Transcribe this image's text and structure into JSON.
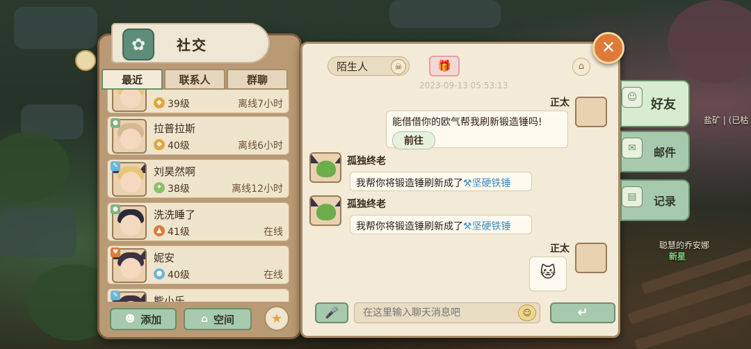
{
  "panel": {
    "title": "社交",
    "tabs": [
      "最近",
      "联系人",
      "群聊"
    ],
    "friends": [
      {
        "name": "",
        "level": "39级",
        "status": "离线7小时",
        "lvl_color": "orange"
      },
      {
        "name": "拉普拉斯",
        "level": "40级",
        "status": "离线6小时",
        "lvl_color": "orange"
      },
      {
        "name": "刘昊然啊",
        "level": "38级",
        "status": "离线12小时",
        "lvl_color": "green"
      },
      {
        "name": "洗洗睡了",
        "level": "41级",
        "status": "在线",
        "lvl_color": "orange"
      },
      {
        "name": "妮安",
        "level": "40级",
        "status": "在线",
        "lvl_color": "blue"
      },
      {
        "name": "熊小乐",
        "level": "",
        "status": "",
        "lvl_color": "orange"
      }
    ],
    "add_label": "添加",
    "space_label": "空间"
  },
  "chat": {
    "tab_label": "陌生人",
    "timestamp": "2023-09-13 05:53:13",
    "messages": [
      {
        "sender": "正太",
        "text": "能借借你的欧气帮我刷新锻造锤吗!",
        "button": "前往"
      },
      {
        "sender": "孤独终老",
        "text": "我帮你将锻造锤刷新成了",
        "item": "坚硬铁锤"
      },
      {
        "sender": "孤独终老",
        "text": "我帮你将锻造锤刷新成了",
        "item": "坚硬铁锤"
      },
      {
        "sender": "正太",
        "sticker": "cat-sticker"
      }
    ],
    "input_placeholder": "在这里输入聊天消息吧"
  },
  "side_tabs": [
    "好友",
    "邮件",
    "记录"
  ],
  "world": {
    "top_right": "盐矿 | (已枯",
    "npc_name": "聪慧的乔安娜",
    "npc_tag": "新星"
  },
  "colors": {
    "accent_green": "#a7c9ad",
    "panel_brown": "#b99a74",
    "close_orange": "#e07a3a",
    "link_blue": "#3a8fc0"
  }
}
